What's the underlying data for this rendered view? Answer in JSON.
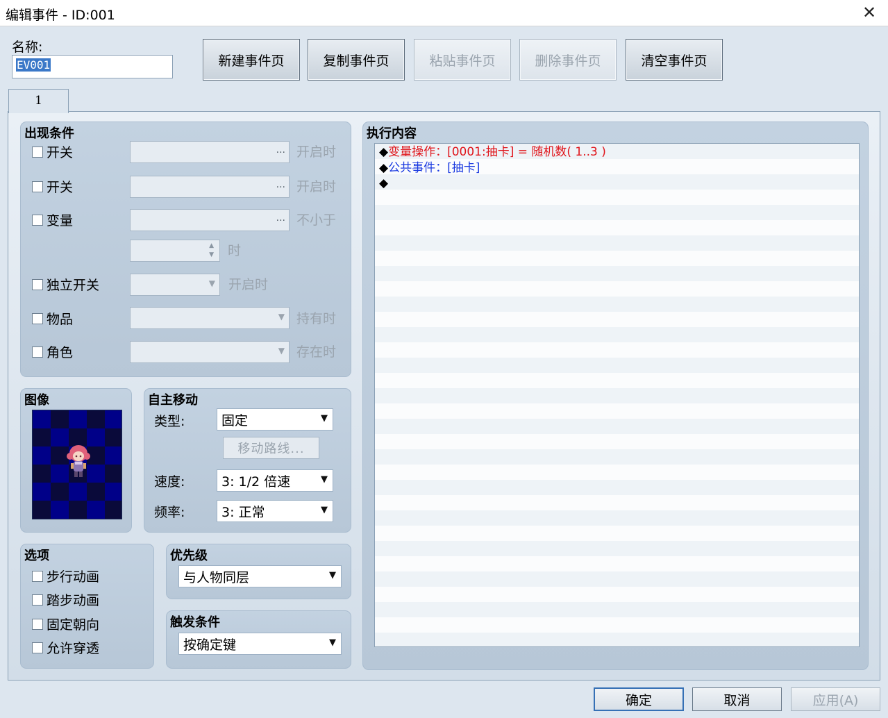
{
  "window": {
    "title": "编辑事件 - ID:001",
    "close_icon": "close-icon"
  },
  "name": {
    "label": "名称:",
    "value": "EV001"
  },
  "toolbar": {
    "new_page": "新建事件页",
    "copy_page": "复制事件页",
    "paste_page": "粘贴事件页",
    "delete_page": "删除事件页",
    "clear_page": "清空事件页"
  },
  "tabs": [
    {
      "label": "1"
    }
  ],
  "conditions": {
    "title": "出现条件",
    "switch1": {
      "label": "开关",
      "dots": "...",
      "suffix": "开启时"
    },
    "switch2": {
      "label": "开关",
      "dots": "...",
      "suffix": "开启时"
    },
    "variable": {
      "label": "变量",
      "dots": "...",
      "suffix": "不小于",
      "value_suffix": "时"
    },
    "self_switch": {
      "label": "独立开关",
      "suffix": "开启时"
    },
    "item": {
      "label": "物品",
      "suffix": "持有时"
    },
    "actor": {
      "label": "角色",
      "suffix": "存在时"
    }
  },
  "image": {
    "title": "图像"
  },
  "autonomous": {
    "title": "自主移动",
    "type_label": "类型:",
    "type_value": "固定",
    "route_button": "移动路线...",
    "speed_label": "速度:",
    "speed_value": "3: 1/2 倍速",
    "freq_label": "频率:",
    "freq_value": "3: 正常"
  },
  "options": {
    "title": "选项",
    "items": [
      "步行动画",
      "踏步动画",
      "固定朝向",
      "允许穿透"
    ]
  },
  "priority": {
    "title": "优先级",
    "value": "与人物同层"
  },
  "trigger": {
    "title": "触发条件",
    "value": "按确定键"
  },
  "contents": {
    "title": "执行内容",
    "lines": [
      {
        "marker": "◆",
        "text": "变量操作：[0001:抽卡] = 随机数( 1..3 )",
        "color": "#e0141a"
      },
      {
        "marker": "◆",
        "text": "公共事件：[抽卡]",
        "color": "#1a3ae0"
      },
      {
        "marker": "◆",
        "text": "",
        "color": "#000000"
      }
    ]
  },
  "footer": {
    "ok": "确定",
    "cancel": "取消",
    "apply": "应用(A)"
  }
}
